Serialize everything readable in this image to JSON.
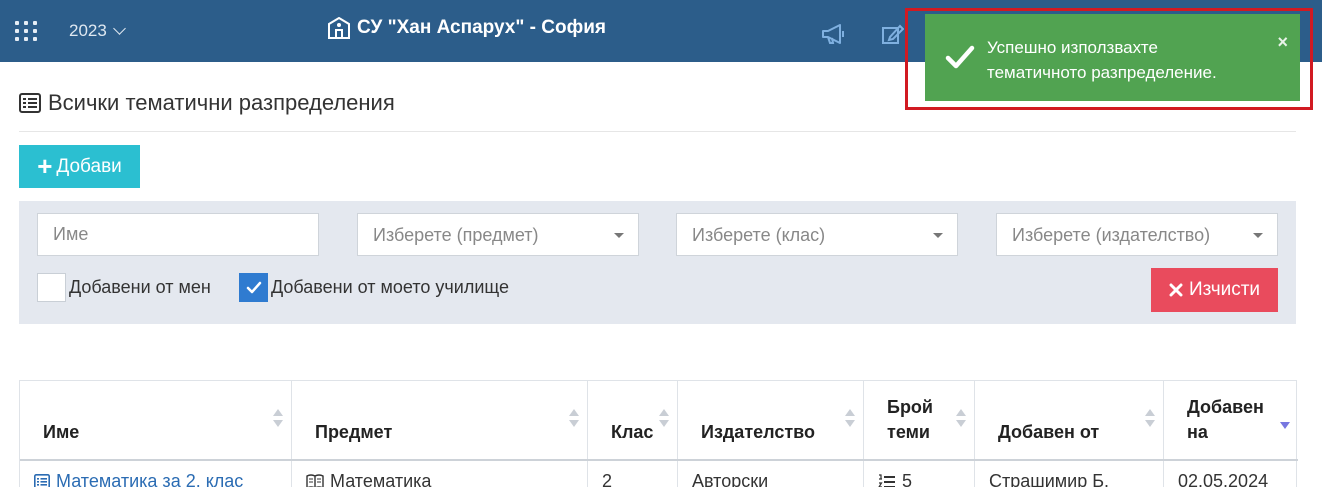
{
  "header": {
    "year": "2023",
    "school_name": "СУ \"Хан Аспарух\" - София",
    "bg_color": "#2c5d8a"
  },
  "toast": {
    "message": "Успешно използвахте тематичното разпределение.",
    "close_label": "×",
    "color": "#51a351"
  },
  "page": {
    "title": "Всички тематични разпределения",
    "add_label": "Добави"
  },
  "filters": {
    "name_placeholder": "Име",
    "subject_placeholder": "Изберете (предмет)",
    "class_placeholder": "Изберете (клас)",
    "publisher_placeholder": "Изберете (издателство)",
    "added_by_me_label": "Добавени от мен",
    "added_by_me_checked": false,
    "added_by_school_label": "Добавени от моето училище",
    "added_by_school_checked": true,
    "clear_label": "Изчисти"
  },
  "table": {
    "columns": [
      "Име",
      "Предмет",
      "Клас",
      "Издателство",
      "Брой теми",
      "Добавен от",
      "Добавен на"
    ],
    "rows": [
      {
        "name": "Математика за 2. клас",
        "subject": "Математика",
        "class": "2",
        "publisher": "Авторски",
        "topics": "5",
        "added_by": "Страшимир Б.",
        "added_on": "02.05.2024"
      }
    ],
    "sorted_column": "Добавен на",
    "sort_direction": "desc"
  }
}
